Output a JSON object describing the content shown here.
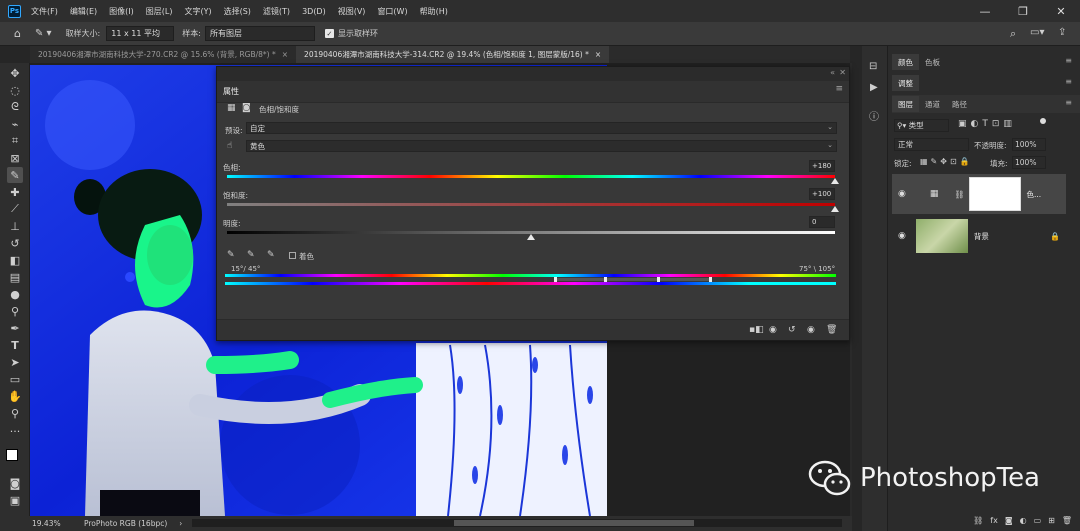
{
  "app": {
    "logo": "Ps"
  },
  "menubar": {
    "items": [
      "文件(F)",
      "编辑(E)",
      "图像(I)",
      "图层(L)",
      "文字(Y)",
      "选择(S)",
      "滤镜(T)",
      "3D(D)",
      "视图(V)",
      "窗口(W)",
      "帮助(H)"
    ]
  },
  "window_controls": {
    "minimize": "—",
    "maximize": "❐",
    "close": "✕"
  },
  "options": {
    "sample_size_label": "取样大小:",
    "sample_size_value": "11 x 11 平均",
    "sample_label": "样本:",
    "sample_value": "所有图层",
    "show_ring_label": "显示取样环"
  },
  "tabs": [
    {
      "label": "20190406湘潭市湖南科技大学-270.CR2 @ 15.6% (背景, RGB/8*) *",
      "close": "×"
    },
    {
      "label": "20190406湘潭市湖南科技大学-314.CR2 @ 19.4% (色相/饱和度 1, 图层蒙版/16) *",
      "close": "×"
    }
  ],
  "properties": {
    "title": "属性",
    "adjustment_name": "色相/饱和度",
    "preset_label": "预设:",
    "preset_value": "自定",
    "channel_value": "黄色",
    "hue_label": "色相:",
    "hue_value": "+180",
    "saturation_label": "饱和度:",
    "saturation_value": "+100",
    "lightness_label": "明度:",
    "lightness_value": "0",
    "colorize_label": "着色",
    "range_left": "15°/ 45°",
    "range_right": "75° \\ 105°",
    "hue_level": 1.0,
    "saturation_level": 1.0,
    "lightness_level": 0.5
  },
  "status": {
    "zoom": "19.43%",
    "profile": "ProPhoto RGB (16bpc)"
  },
  "right_panels": {
    "top_tabs": [
      "颜色",
      "色板"
    ],
    "adjust_tab": "调整",
    "layer_tabs": [
      "图层",
      "通道",
      "路径"
    ],
    "filter_kind": "类型",
    "blend_mode": "正常",
    "opacity_label": "不透明度:",
    "opacity_value": "100%",
    "lock_label": "锁定:",
    "fill_label": "填充:",
    "fill_value": "100%",
    "layers": [
      {
        "name": "色..."
      },
      {
        "name": "背景"
      }
    ]
  },
  "watermark": {
    "text": "PhotoshopTea"
  }
}
